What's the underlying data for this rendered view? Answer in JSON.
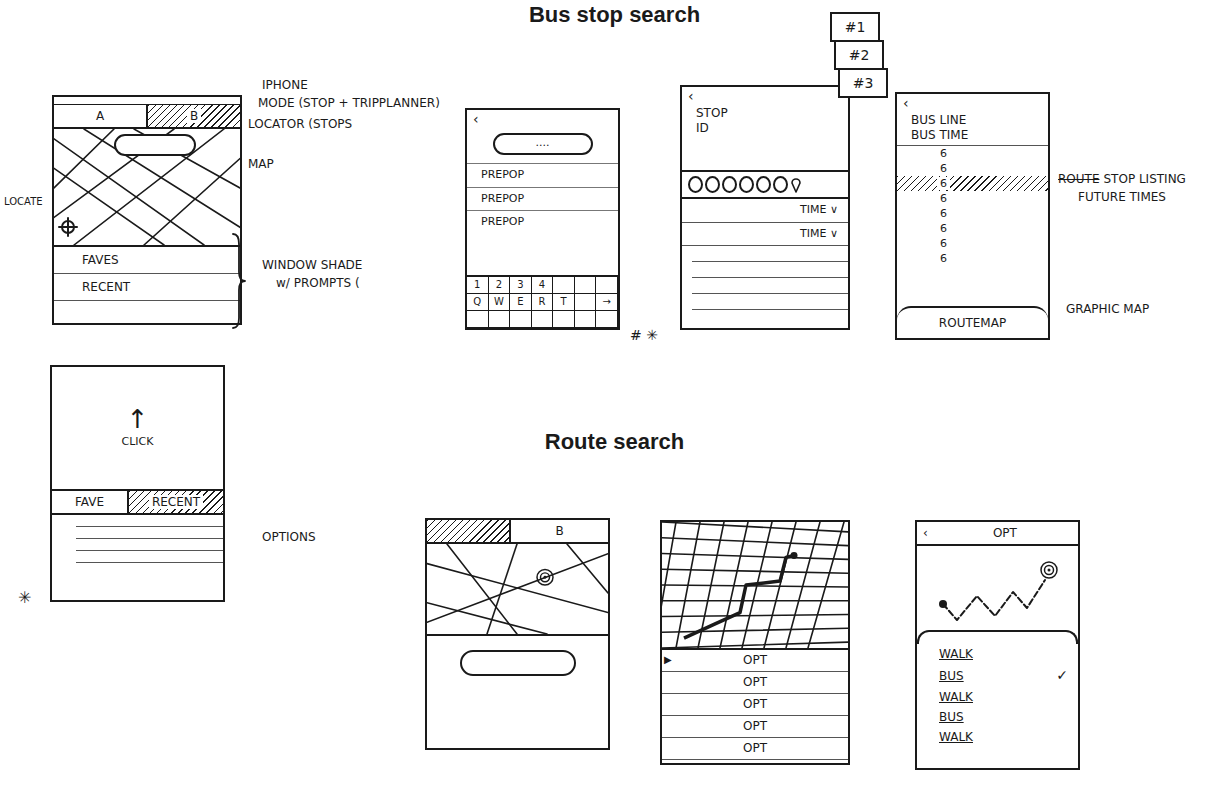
{
  "headings": {
    "bus_stop": "Bus stop search",
    "route": "Route search"
  },
  "home": {
    "tabs": [
      {
        "label": "A",
        "selected": false
      },
      {
        "label": "B",
        "selected": true
      }
    ],
    "items": [
      "FAVES",
      "RECENT"
    ],
    "notes": [
      "IPHONE",
      "MODE (STOP + TRIPPLANNER)",
      "LOCATOR (STOPS",
      "MAP",
      "WINDOW SHADE",
      "w/ PROMPTS ("
    ],
    "locate_note": "LOCATE"
  },
  "shade": {
    "arrow": "↑",
    "hint": "CLICK",
    "tabs": [
      {
        "label": "FAVE",
        "selected": false
      },
      {
        "label": "RECENT",
        "selected": true
      }
    ],
    "note": "OPTIONS",
    "mark": "✳"
  },
  "search": {
    "back": "‹",
    "field": "....",
    "items": [
      "PREPOP",
      "PREPOP",
      "PREPOP"
    ],
    "keys": [
      [
        "1",
        "2",
        "3",
        "4"
      ],
      [
        "Q",
        "W",
        "E",
        "R",
        "T"
      ]
    ],
    "enter": "→",
    "marks": "# ✳"
  },
  "stop": {
    "back": "‹",
    "title": [
      "STOP",
      "ID"
    ],
    "times": [
      "TIME ∨",
      "TIME ∨"
    ],
    "cards": [
      "#1",
      "#2",
      "#3"
    ]
  },
  "line": {
    "back": "‹",
    "title": "BUS LINE",
    "subtitle": "BUS TIME",
    "stops": [
      {
        "label": "6",
        "selected": false
      },
      {
        "label": "6",
        "selected": false
      },
      {
        "label": "6",
        "selected": true
      },
      {
        "label": "6",
        "selected": false
      },
      {
        "label": "6",
        "selected": false
      },
      {
        "label": "6",
        "selected": false
      },
      {
        "label": "6",
        "selected": false
      },
      {
        "label": "6",
        "selected": false
      }
    ],
    "button": "ROUTEMAP",
    "notes": [
      {
        "text": "ROUTE",
        "struck": true
      },
      {
        "text": "STOP LISTING",
        "struck": false
      }
    ],
    "notes_line2": "FUTURE TIMES",
    "button_note": "GRAPHIC MAP"
  },
  "route_map": {
    "tabs": [
      {
        "label": "",
        "selected": true
      },
      {
        "label": "B",
        "selected": false
      }
    ]
  },
  "route_list": {
    "marker": "▶",
    "options": [
      "OPT",
      "OPT",
      "OPT",
      "OPT",
      "OPT"
    ]
  },
  "route_detail": {
    "back": "‹",
    "title": "OPT",
    "check": "✓",
    "legs": [
      {
        "label": "WALK",
        "selected": false
      },
      {
        "label": "BUS",
        "selected": true
      },
      {
        "label": "WALK",
        "selected": false
      },
      {
        "label": "BUS",
        "selected": false
      },
      {
        "label": "WALK",
        "selected": false
      }
    ]
  }
}
